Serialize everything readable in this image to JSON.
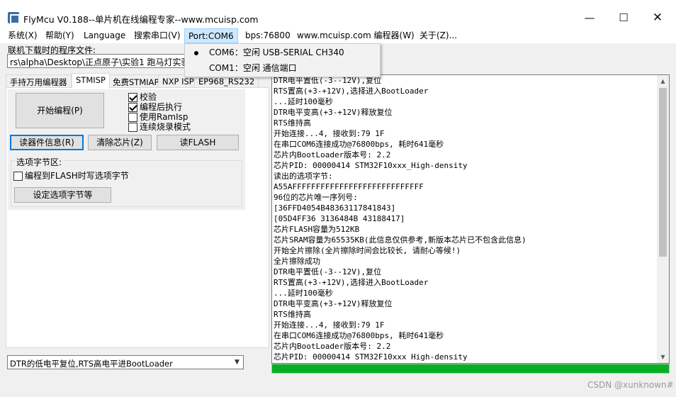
{
  "window": {
    "title": "FlyMcu V0.188--单片机在线编程专家--www.mcuisp.com"
  },
  "menu": {
    "system": "系统(X)",
    "help": "帮助(Y)",
    "language": "Language",
    "search_port": "搜索串口(V)",
    "port": "Port:COM6",
    "bps": "bps:76800",
    "programmer": "www.mcuisp.com 编程器(W)",
    "about": "关于(Z)..."
  },
  "port_menu": {
    "items": [
      {
        "label": "COM6：空闲 USB-SERIAL CH340",
        "selected": true
      },
      {
        "label": "COM1：空闲 通信端口",
        "selected": false
      }
    ]
  },
  "download": {
    "label": "联机下载时的程序文件:",
    "path_value": "rs\\alpha\\Desktop\\正点原子\\实验1 跑马灯实验\\OU"
  },
  "tabs": [
    "手持万用编程器",
    "STMISP",
    "免费STMIAP",
    "NXP ISP",
    "EP968_RS232"
  ],
  "active_tab": "STMISP",
  "buttons": {
    "start": "开始编程(P)",
    "read_info": "读器件信息(R)",
    "clear_chip": "清除芯片(Z)",
    "read_flash": "读FLASH",
    "set_option": "设定选项字节等"
  },
  "checkboxes": [
    {
      "label": "校验",
      "checked": true
    },
    {
      "label": "编程后执行",
      "checked": true
    },
    {
      "label": "使用RamIsp",
      "checked": false
    },
    {
      "label": "连续烧录模式",
      "checked": false
    }
  ],
  "option_group": {
    "title": "选项字节区:",
    "checkbox_label": "编程到FLASH时写选项字节",
    "checked": false
  },
  "reset_select": {
    "value": "DTR的低电平复位,RTS高电平进BootLoader"
  },
  "log": [
    "DTR电平置低(-3--12V),复位",
    "RTS置高(+3-+12V),选择进入BootLoader",
    "...延时100毫秒",
    "DTR电平变高(+3-+12V)释放复位",
    "RTS维持高",
    "开始连接...4, 接收到:79 1F",
    "在串口COM6连接成功@76800bps, 耗时641毫秒",
    "芯片内BootLoader版本号: 2.2",
    "芯片PID: 00000414  STM32F10xxx_High-density",
    "读出的选项字节:",
    "A55AFFFFFFFFFFFFFFFFFFFFFFFFFFFF",
    "96位的芯片唯一序列号:",
    "[36FFD4054B48363117841843]",
    "[05D4FF36 3136484B 43188417]",
    "芯片FLASH容量为512KB",
    "芯片SRAM容量为65535KB(此信息仅供参考,新版本芯片已不包含此信息)",
    "开始全片擦除(全片擦除时间会比较长, 请耐心等候!)",
    "全片擦除成功",
    "DTR电平置低(-3--12V),复位",
    "RTS置高(+3-+12V),选择进入BootLoader",
    "...延时100毫秒",
    "DTR电平变高(+3-+12V)释放复位",
    "RTS维持高",
    "开始连接...4, 接收到:79 1F",
    "在串口COM6连接成功@76800bps, 耗时641毫秒",
    "芯片内BootLoader版本号: 2.2",
    "芯片PID: 00000414  STM32F10xxx High-density"
  ],
  "progress": {
    "fraction": 1.0,
    "color": "#06b025"
  },
  "watermark": "CSDN @xunknown#"
}
